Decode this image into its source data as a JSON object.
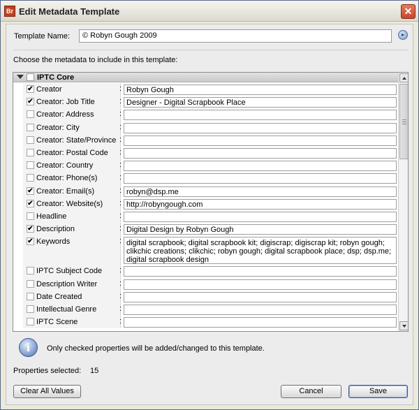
{
  "window": {
    "app_icon_text": "Br",
    "title": "Edit Metadata Template",
    "close_glyph": "✕"
  },
  "template": {
    "name_label": "Template Name:",
    "name_value": "© Robyn Gough 2009",
    "menu_glyph": "▸"
  },
  "instruction": "Choose the metadata to include in this template:",
  "group": {
    "label": "IPTC Core",
    "expanded": true
  },
  "rows": [
    {
      "label": "Creator",
      "checked": true,
      "value": "Robyn Gough"
    },
    {
      "label": "Creator: Job Title",
      "checked": true,
      "value": "Designer - Digital Scrapbook Place"
    },
    {
      "label": "Creator: Address",
      "checked": false,
      "value": ""
    },
    {
      "label": "Creator: City",
      "checked": false,
      "value": ""
    },
    {
      "label": "Creator: State/Province",
      "checked": false,
      "value": ""
    },
    {
      "label": "Creator: Postal Code",
      "checked": false,
      "value": ""
    },
    {
      "label": "Creator: Country",
      "checked": false,
      "value": ""
    },
    {
      "label": "Creator: Phone(s)",
      "checked": false,
      "value": ""
    },
    {
      "label": "Creator: Email(s)",
      "checked": true,
      "value": "robyn@dsp.me"
    },
    {
      "label": "Creator: Website(s)",
      "checked": true,
      "value": "http://robyngough.com"
    },
    {
      "label": "Headline",
      "checked": false,
      "value": ""
    },
    {
      "label": "Description",
      "checked": true,
      "value": "Digital Design by Robyn Gough"
    },
    {
      "label": "Keywords",
      "checked": true,
      "value": "digital scrapbook; digital scrapbook kit; digiscrap; digiscrap kit; robyn gough; clikchic creations; clikchic; robyn gough; digital scrapbook place; dsp; dsp.me; digital scrapbook design",
      "tall": true
    },
    {
      "label": "IPTC Subject Code",
      "checked": false,
      "value": ""
    },
    {
      "label": "Description Writer",
      "checked": false,
      "value": ""
    },
    {
      "label": "Date Created",
      "checked": false,
      "value": ""
    },
    {
      "label": "Intellectual Genre",
      "checked": false,
      "value": ""
    },
    {
      "label": "IPTC Scene",
      "checked": false,
      "value": ""
    }
  ],
  "info": {
    "icon": "info-icon",
    "text": "Only checked properties will be added/changed to this template."
  },
  "properties": {
    "label": "Properties selected:",
    "count": "15"
  },
  "buttons": {
    "clear": "Clear All Values",
    "cancel": "Cancel",
    "save": "Save"
  },
  "check_glyph": "✔"
}
